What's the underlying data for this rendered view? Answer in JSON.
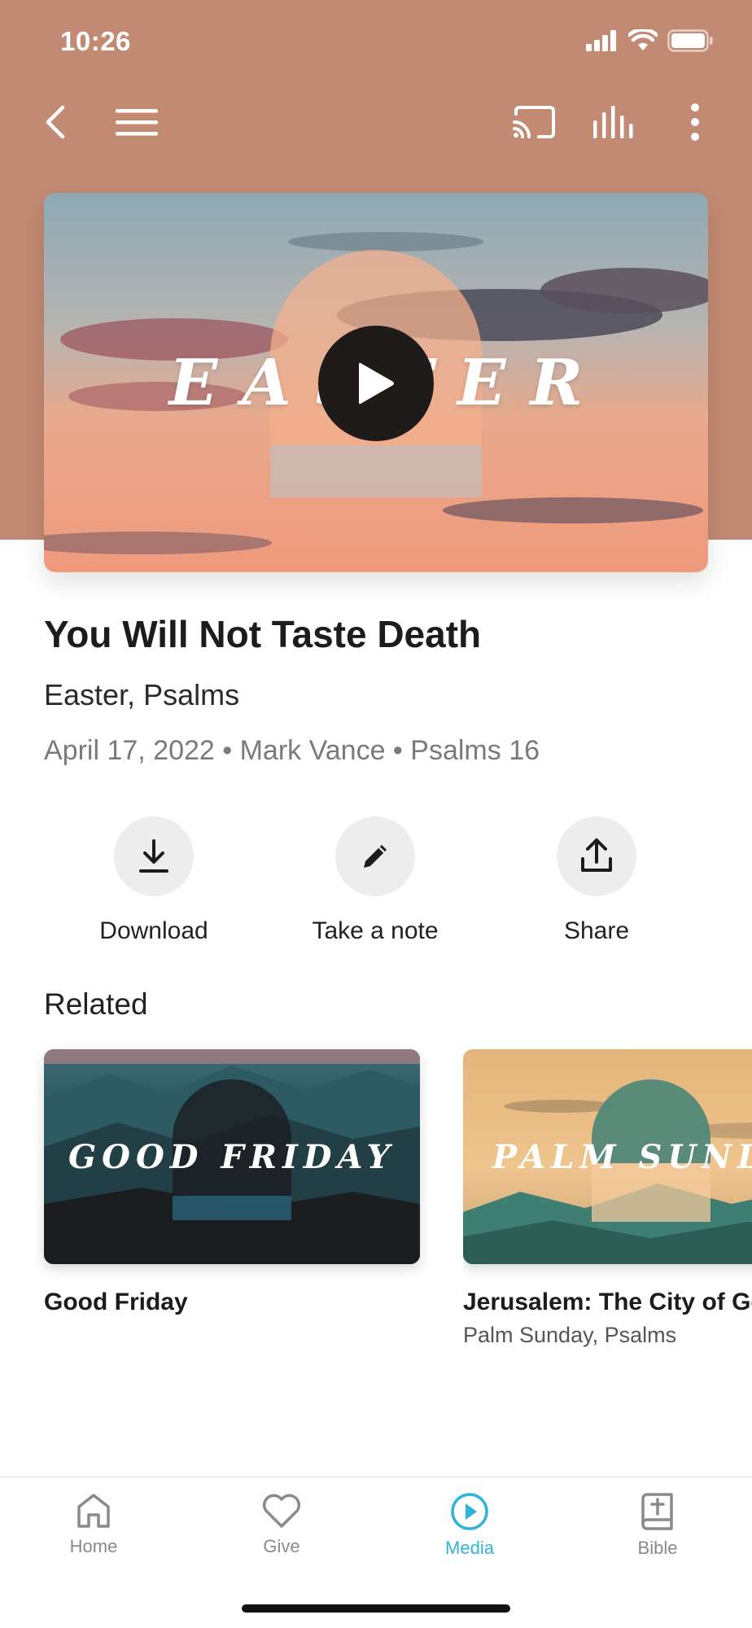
{
  "status_bar": {
    "time": "10:26"
  },
  "toolbar": {
    "icons": [
      "back-icon",
      "menu-icon",
      "cast-icon",
      "audio-bars-icon",
      "more-vertical-icon"
    ]
  },
  "hero": {
    "artwork_title": "EASTER",
    "play_icon": "play-icon"
  },
  "sermon": {
    "title": "You Will Not Taste Death",
    "series": "Easter, Psalms",
    "meta": "April 17, 2022 • Mark Vance • Psalms 16"
  },
  "actions": [
    {
      "label": "Download",
      "icon": "download-icon"
    },
    {
      "label": "Take a note",
      "icon": "pencil-icon"
    },
    {
      "label": "Share",
      "icon": "share-icon"
    }
  ],
  "related": {
    "heading": "Related",
    "items": [
      {
        "artwork_title": "GOOD FRIDAY",
        "title": "Good Friday",
        "subtitle": ""
      },
      {
        "artwork_title": "PALM SUNDAY",
        "title": "Jerusalem: The City of God",
        "subtitle": "Palm Sunday, Psalms"
      }
    ]
  },
  "tabbar": {
    "active": "Media",
    "active_color": "#2fb3dd",
    "tabs": [
      {
        "label": "Home",
        "icon": "home-icon"
      },
      {
        "label": "Give",
        "icon": "heart-icon"
      },
      {
        "label": "Media",
        "icon": "play-circle-icon"
      },
      {
        "label": "Bible",
        "icon": "bible-icon"
      }
    ]
  },
  "colors": {
    "header_background": "#c28a72",
    "accent": "#2fb3dd"
  }
}
